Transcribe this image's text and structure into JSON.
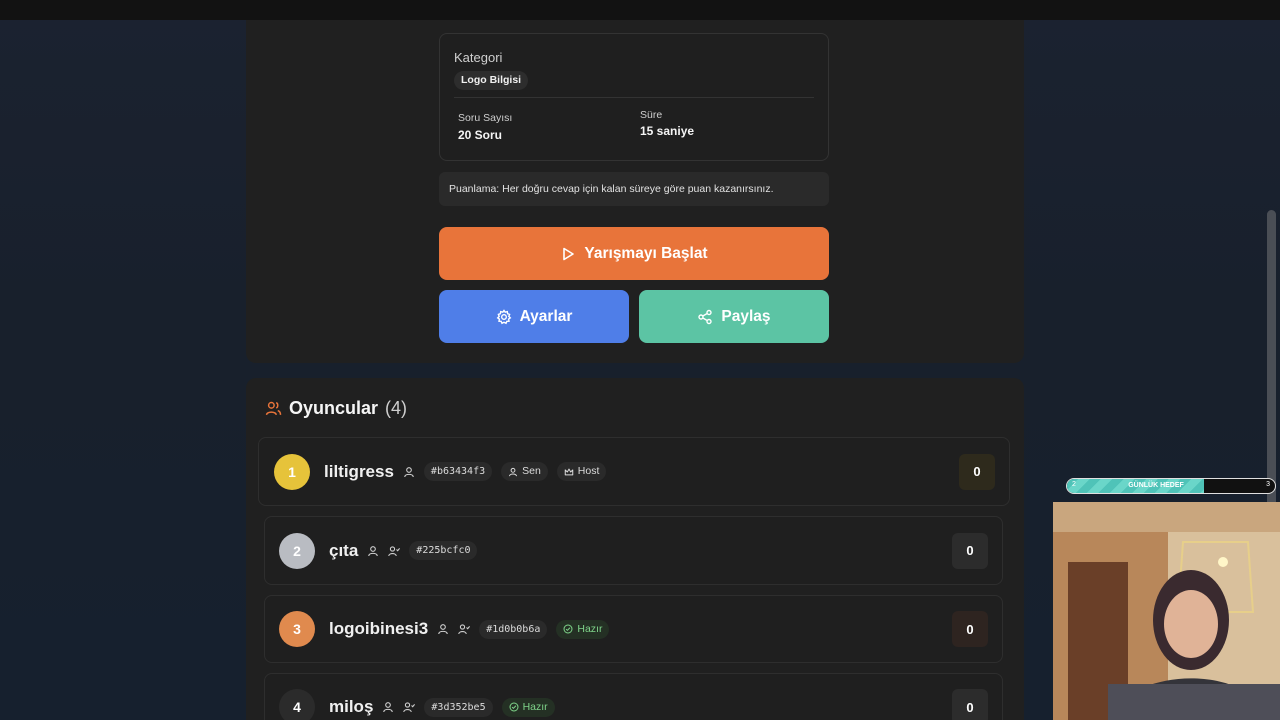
{
  "quiz_info": {
    "category_label": "Kategori",
    "category_value": "Logo Bilgisi",
    "question_count_label": "Soru Sayısı",
    "question_count_value": "20 Soru",
    "duration_label": "Süre",
    "duration_value": "15 saniye"
  },
  "scoring_note": "Puanlama: Her doğru cevap için kalan süreye göre puan kazanırsınız.",
  "buttons": {
    "start": "Yarışmayı Başlat",
    "settings": "Ayarlar",
    "share": "Paylaş"
  },
  "players": {
    "title": "Oyuncular",
    "count": "(4)",
    "list": [
      {
        "rank": "1",
        "name": "liltigress",
        "id": "#b63434f3",
        "you_label": "Sen",
        "host_label": "Host",
        "score": "0"
      },
      {
        "rank": "2",
        "name": "çıta",
        "id": "#225bcfc0",
        "score": "0"
      },
      {
        "rank": "3",
        "name": "logoibinesi3",
        "id": "#1d0b0b6a",
        "status": "Hazır",
        "score": "0"
      },
      {
        "rank": "4",
        "name": "miloş",
        "id": "#3d352be5",
        "status": "Hazır",
        "score": "0"
      }
    ]
  },
  "rank_colors": {
    "1": "#e6c33a",
    "2": "#b9bcc2",
    "3": "#e08a4e",
    "4": "#2b2b2b"
  },
  "overlay": {
    "goal_label": "GÜNLÜK HEDEF",
    "goal_current": "2",
    "goal_target": "3",
    "goal_progress": 0.66
  }
}
